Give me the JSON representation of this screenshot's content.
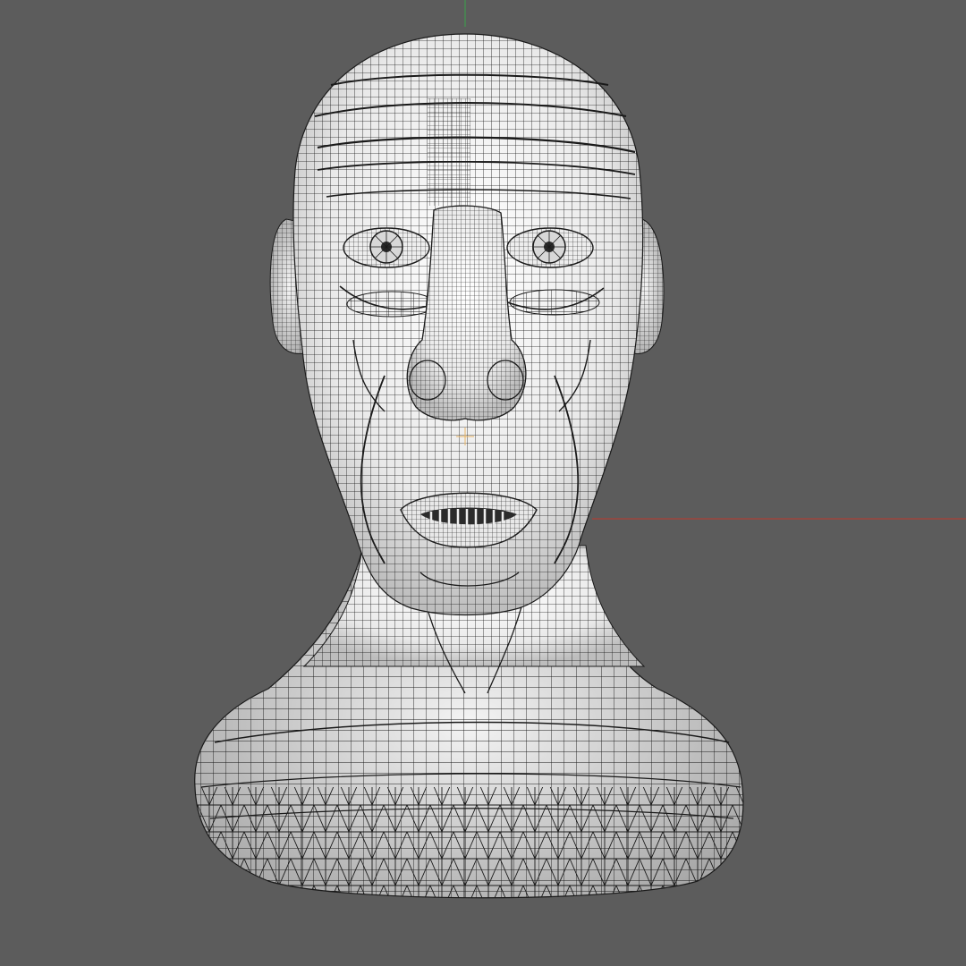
{
  "viewport": {
    "background": "#5c5c5c",
    "shading": "white-shaded-with-wireframe",
    "view": "front"
  },
  "axes": {
    "x_axis_color": "#c0392b",
    "y_axis_color": "#3aa34a"
  },
  "model": {
    "subject": "head-bust",
    "base_color": "#f2f2f2",
    "wire_color": "#1a1a1a"
  }
}
